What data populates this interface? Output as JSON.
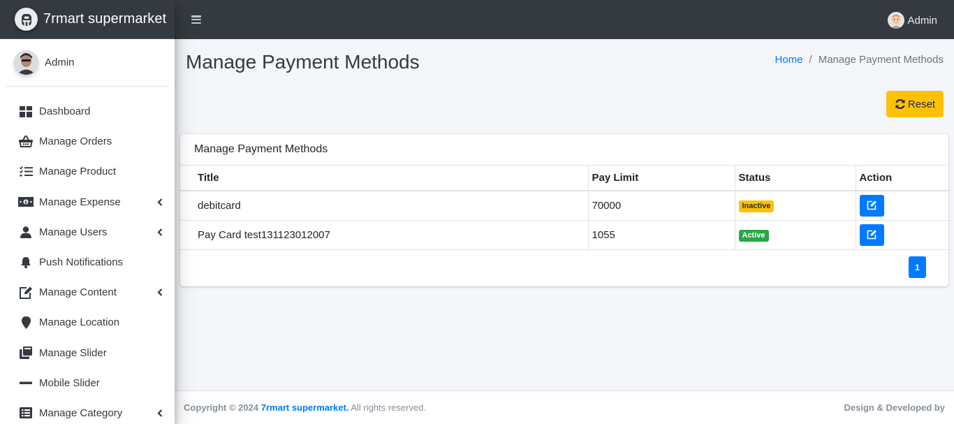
{
  "brand": {
    "name": "7rmart supermarket",
    "logo_icon": "brand-logo-icon"
  },
  "sidebar": {
    "user": "Admin",
    "items": [
      {
        "label": "Dashboard",
        "icon": "dashboard-grid-icon",
        "has_submenu": false
      },
      {
        "label": "Manage Orders",
        "icon": "basket-icon",
        "has_submenu": false
      },
      {
        "label": "Manage Product",
        "icon": "tasks-list-icon",
        "has_submenu": false
      },
      {
        "label": "Manage Expense",
        "icon": "money-bill-icon",
        "has_submenu": true
      },
      {
        "label": "Manage Users",
        "icon": "user-icon",
        "has_submenu": true
      },
      {
        "label": "Push Notifications",
        "icon": "bell-icon",
        "has_submenu": false
      },
      {
        "label": "Manage Content",
        "icon": "edit-icon",
        "has_submenu": true
      },
      {
        "label": "Manage Location",
        "icon": "map-marker-icon",
        "has_submenu": false
      },
      {
        "label": "Manage Slider",
        "icon": "clone-icon",
        "has_submenu": false
      },
      {
        "label": "Mobile Slider",
        "icon": "minus-icon",
        "has_submenu": false
      },
      {
        "label": "Manage Category",
        "icon": "list-alt-icon",
        "has_submenu": true
      }
    ]
  },
  "topbar": {
    "user": "Admin"
  },
  "page": {
    "title": "Manage Payment Methods",
    "breadcrumb": {
      "home": "Home",
      "separator": "/",
      "current": "Manage Payment Methods"
    },
    "reset_label": "Reset"
  },
  "card": {
    "title": "Manage Payment Methods",
    "columns": [
      "Title",
      "Pay Limit",
      "Status",
      "Action"
    ],
    "rows": [
      {
        "title": "debitcard",
        "pay_limit": "70000",
        "status": "Inactive"
      },
      {
        "title": "Pay Card test131123012007",
        "pay_limit": "1055",
        "status": "Active"
      }
    ],
    "pagination": {
      "current_page": "1"
    }
  },
  "footer": {
    "copyright_prefix": "Copyright © 2024",
    "brand_link": "7rmart supermarket.",
    "rights": "All rights reserved.",
    "right_text": "Design & Developed by"
  },
  "colors": {
    "topbar": "#343a40",
    "accent": "#007bff",
    "warning": "#ffc107",
    "success": "#28a745"
  }
}
